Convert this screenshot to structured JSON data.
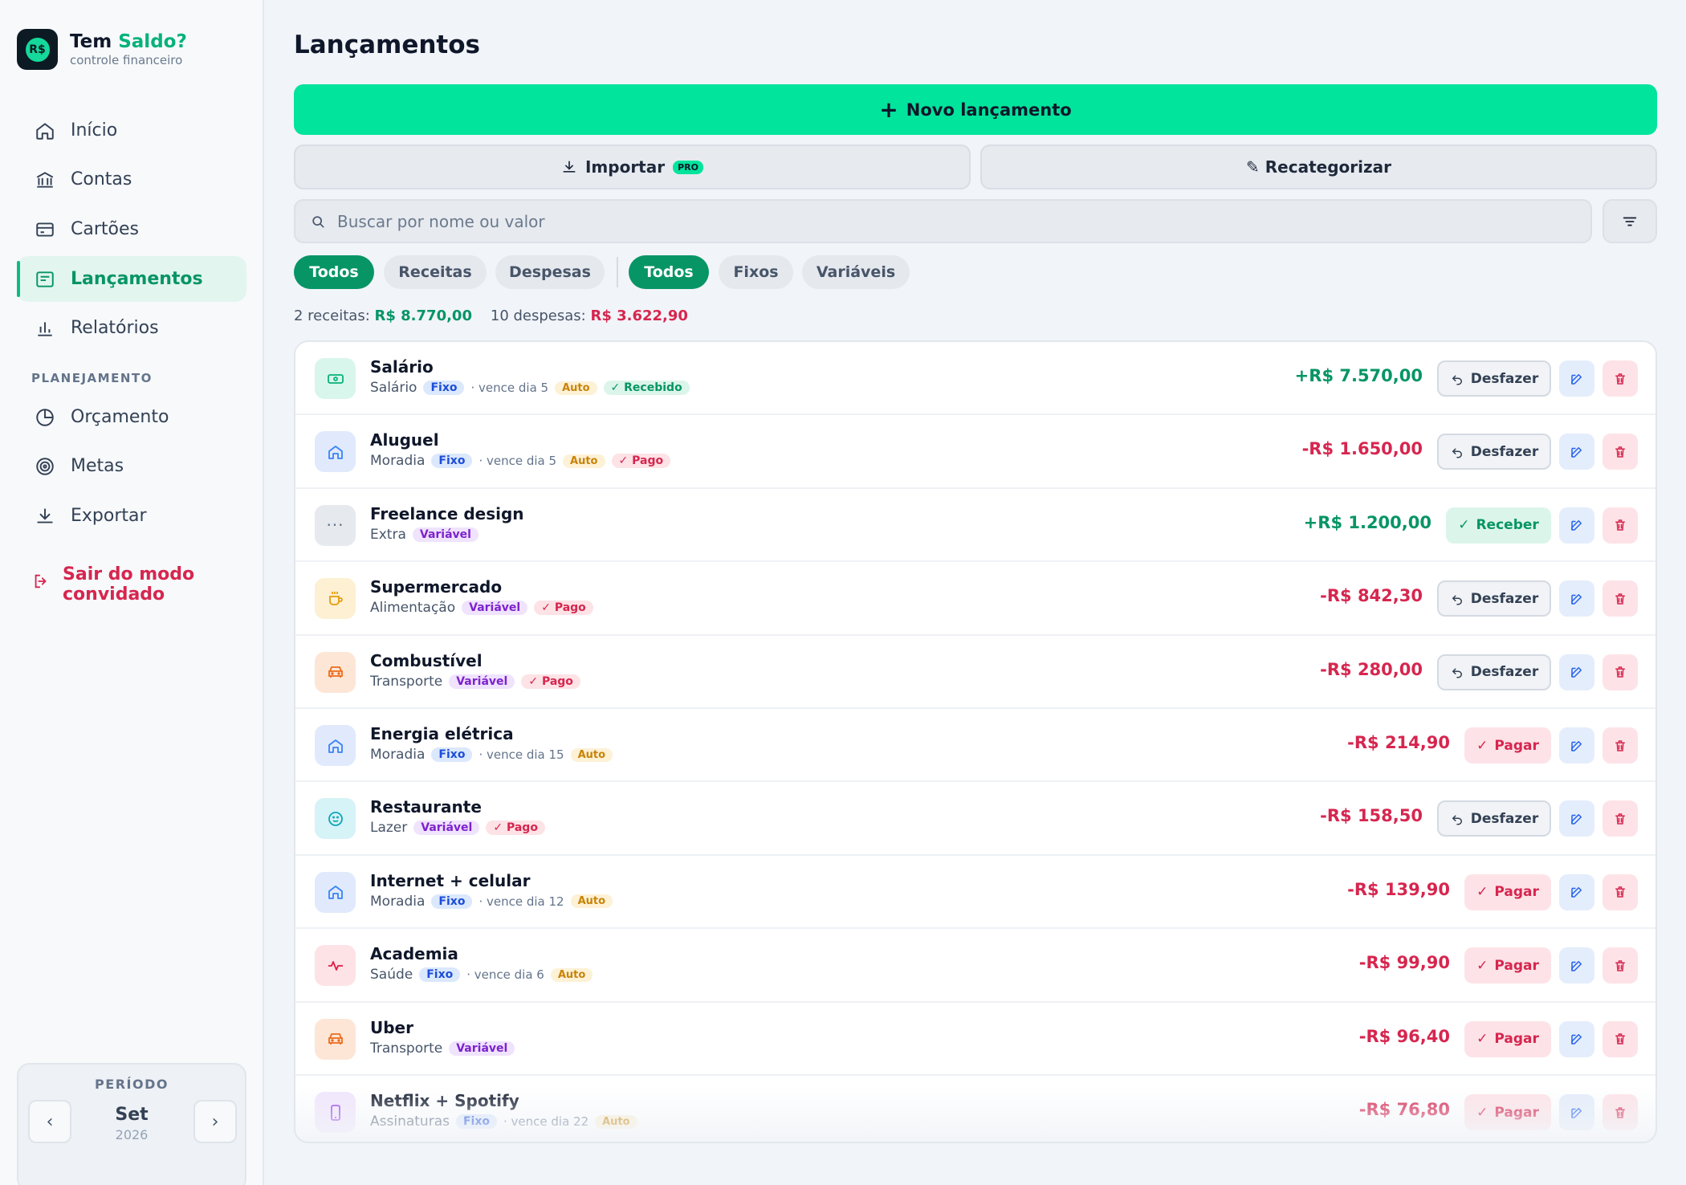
{
  "brand": {
    "name_part1": "Tem",
    "name_part2": "Saldo?",
    "subtitle": "controle financeiro",
    "logo_text": "R$"
  },
  "nav": {
    "items": [
      {
        "label": "Início",
        "icon": "home-icon"
      },
      {
        "label": "Contas",
        "icon": "bank-icon"
      },
      {
        "label": "Cartões",
        "icon": "card-icon"
      },
      {
        "label": "Lançamentos",
        "icon": "list-icon",
        "active": true
      },
      {
        "label": "Relatórios",
        "icon": "bar-chart-icon"
      }
    ],
    "section_label": "PLANEJAMENTO",
    "planning": [
      {
        "label": "Orçamento",
        "icon": "pie-icon"
      },
      {
        "label": "Metas",
        "icon": "target-icon"
      },
      {
        "label": "Exportar",
        "icon": "download-icon"
      }
    ],
    "logout_line1": "Sair do modo",
    "logout_line2": "convidado"
  },
  "period": {
    "label": "PERÍODO",
    "month": "Set",
    "year": "2026"
  },
  "page": {
    "title": "Lançamentos"
  },
  "actions": {
    "new_label": "Novo lançamento",
    "import_label": "Importar",
    "pro_badge": "PRO",
    "recategorize_label": "✎ Recategorizar"
  },
  "search": {
    "placeholder": "Buscar por nome ou valor"
  },
  "filters": {
    "type": [
      "Todos",
      "Receitas",
      "Despesas"
    ],
    "kind": [
      "Todos",
      "Fixos",
      "Variáveis"
    ]
  },
  "summary": {
    "income_label": "2 receitas:",
    "income_value": "R$ 8.770,00",
    "expense_label": "10 despesas:",
    "expense_value": "R$ 3.622,90"
  },
  "colors": {
    "accent": "#00e49c",
    "income": "#079566",
    "expense": "#d6264f",
    "active_nav": "#e2f5ee"
  },
  "entries": [
    {
      "name": "Salário",
      "category": "Salário",
      "kind": "Fixo",
      "due": "· vence dia 5",
      "auto": "Auto",
      "status": "Recebido",
      "amount": "+R$ 7.570,00",
      "action": "Desfazer",
      "icon": "money-icon"
    },
    {
      "name": "Aluguel",
      "category": "Moradia",
      "kind": "Fixo",
      "due": "· vence dia 5",
      "auto": "Auto",
      "status": "Pago",
      "amount": "-R$ 1.650,00",
      "action": "Desfazer",
      "icon": "house-icon"
    },
    {
      "name": "Freelance design",
      "category": "Extra",
      "kind": "Variável",
      "due": "",
      "auto": "",
      "status": "",
      "amount": "+R$ 1.200,00",
      "action": "Receber",
      "icon": "dots-icon"
    },
    {
      "name": "Supermercado",
      "category": "Alimentação",
      "kind": "Variável",
      "due": "",
      "auto": "",
      "status": "Pago",
      "amount": "-R$ 842,30",
      "action": "Desfazer",
      "icon": "cup-icon"
    },
    {
      "name": "Combustível",
      "category": "Transporte",
      "kind": "Variável",
      "due": "",
      "auto": "",
      "status": "Pago",
      "amount": "-R$ 280,00",
      "action": "Desfazer",
      "icon": "car-icon"
    },
    {
      "name": "Energia elétrica",
      "category": "Moradia",
      "kind": "Fixo",
      "due": "· vence dia 15",
      "auto": "Auto",
      "status": "",
      "amount": "-R$ 214,90",
      "action": "Pagar",
      "icon": "house-icon"
    },
    {
      "name": "Restaurante",
      "category": "Lazer",
      "kind": "Variável",
      "due": "",
      "auto": "",
      "status": "Pago",
      "amount": "-R$ 158,50",
      "action": "Desfazer",
      "icon": "smile-icon"
    },
    {
      "name": "Internet + celular",
      "category": "Moradia",
      "kind": "Fixo",
      "due": "· vence dia 12",
      "auto": "Auto",
      "status": "",
      "amount": "-R$ 139,90",
      "action": "Pagar",
      "icon": "house-icon"
    },
    {
      "name": "Academia",
      "category": "Saúde",
      "kind": "Fixo",
      "due": "· vence dia 6",
      "auto": "Auto",
      "status": "",
      "amount": "-R$ 99,90",
      "action": "Pagar",
      "icon": "pulse-icon"
    },
    {
      "name": "Uber",
      "category": "Transporte",
      "kind": "Variável",
      "due": "",
      "auto": "",
      "status": "",
      "amount": "-R$ 96,40",
      "action": "Pagar",
      "icon": "car-icon"
    },
    {
      "name": "Netflix + Spotify",
      "category": "Assinaturas",
      "kind": "Fixo",
      "due": "· vence dia 22",
      "auto": "Auto",
      "status": "",
      "amount": "-R$ 76,80",
      "action": "Pagar",
      "icon": "phone-icon"
    }
  ]
}
